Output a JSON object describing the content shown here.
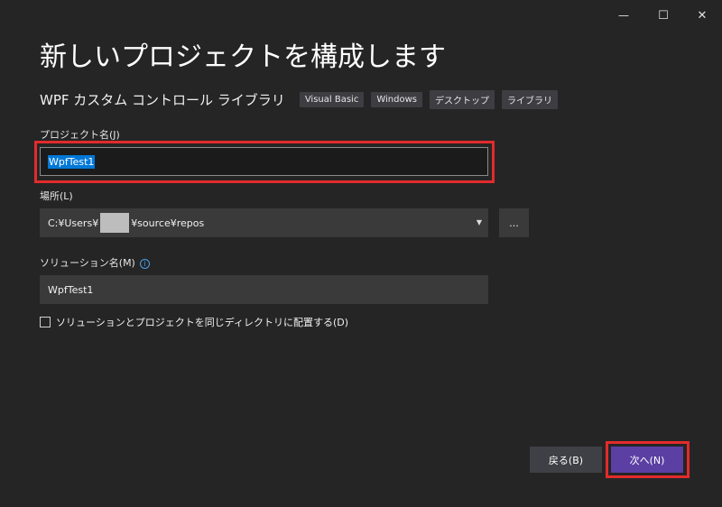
{
  "window": {
    "minimize_icon": "minimize-icon",
    "maximize_icon": "maximize-icon",
    "close_icon": "close-icon",
    "minimize": "—",
    "maximize": "☐",
    "close": "✕"
  },
  "title": "新しいプロジェクトを構成します",
  "template": {
    "name": "WPF カスタム コントロール ライブラリ",
    "tags": [
      "Visual Basic",
      "Windows",
      "デスクトップ",
      "ライブラリ"
    ]
  },
  "project_name": {
    "label": "プロジェクト名(J)",
    "value": "WpfTest1"
  },
  "location": {
    "label": "場所(L)",
    "value_prefix": "C:¥Users¥",
    "value_suffix": "¥source¥repos",
    "browse_label": "..."
  },
  "solution_name": {
    "label": "ソリューション名(M)",
    "info_icon": "info-icon",
    "info_glyph": "i",
    "value": "WpfTest1"
  },
  "same_directory": {
    "label": "ソリューションとプロジェクトを同じディレクトリに配置する(D)",
    "checked": false
  },
  "buttons": {
    "back": "戻る(B)",
    "next": "次へ(N)"
  },
  "colors": {
    "background": "#252526",
    "accent": "#5b3fa3",
    "selection": "#0078d7",
    "highlight_box": "#e32b2b"
  }
}
